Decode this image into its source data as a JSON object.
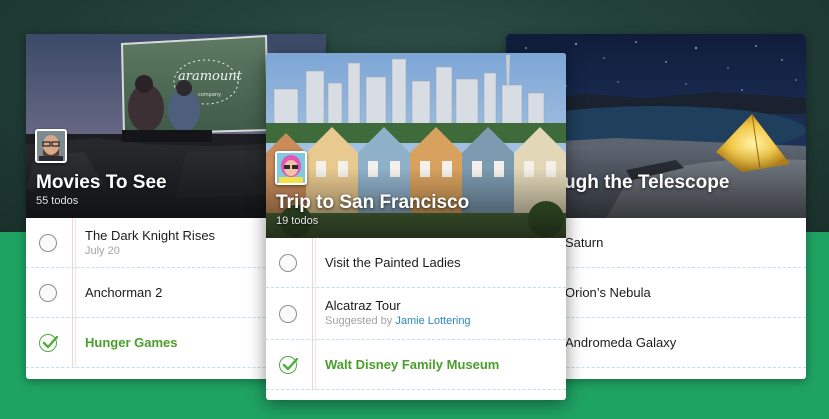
{
  "colors": {
    "background_dark": "#22403a",
    "background_green": "#1fa363",
    "done_green": "#4a9e2c",
    "link_blue": "#2a86c4"
  },
  "cards": {
    "left": {
      "title": "Movies To See",
      "count": "55 todos",
      "items": [
        {
          "text": "The Dark Knight Rises",
          "sub": "July 20",
          "done": false
        },
        {
          "text": "Anchorman 2",
          "done": false
        },
        {
          "text": "Hunger Games",
          "done": true
        }
      ]
    },
    "middle": {
      "title": "Trip to San Francisco",
      "count": "19 todos",
      "items": [
        {
          "text": "Visit the Painted Ladies",
          "done": false
        },
        {
          "text": "Alcatraz Tour",
          "sub_prefix": "Suggested by",
          "sub_link": "Jamie Lottering",
          "done": false
        },
        {
          "text": "Walt Disney Family Museum",
          "done": true
        }
      ]
    },
    "right": {
      "title": "ugh the Telescope",
      "items": [
        {
          "text": "Saturn"
        },
        {
          "text": "Orion’s Nebula"
        },
        {
          "text": "Andromeda Galaxy"
        }
      ]
    }
  },
  "icons": {
    "checkbox_empty": "circle-checkbox-icon",
    "checkbox_done": "checkmark-icon"
  }
}
